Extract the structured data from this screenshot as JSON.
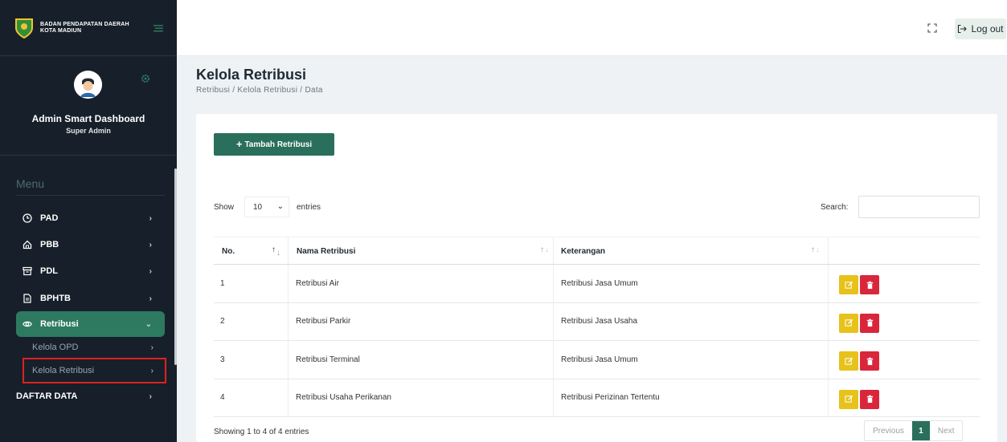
{
  "brand": {
    "text_line1": "BADAN PENDAPATAN DAERAH",
    "text_line2": "KOTA MADIUN",
    "logo_icon": "city-crest-icon",
    "toggle_icon": "menu-toggle-icon"
  },
  "profile": {
    "name": "Admin Smart Dashboard",
    "role": "Super Admin",
    "avatar_icon": "user-avatar-icon",
    "settings_icon": "gear-icon"
  },
  "menu": {
    "header": "Menu",
    "items": [
      {
        "label": "PAD",
        "icon": "clock-icon"
      },
      {
        "label": "PBB",
        "icon": "home-icon"
      },
      {
        "label": "PDL",
        "icon": "archive-icon"
      },
      {
        "label": "BPHTB",
        "icon": "document-icon"
      },
      {
        "label": "Retribusi",
        "icon": "eye-icon",
        "active": true
      }
    ],
    "subitems": [
      {
        "label": "Kelola OPD"
      },
      {
        "label": "Kelola Retribusi"
      }
    ],
    "extra": {
      "label": "DAFTAR DATA"
    }
  },
  "topbar": {
    "fullscreen_icon": "fullscreen-icon",
    "logout_label": "Log out",
    "logout_icon": "logout-icon"
  },
  "page": {
    "title": "Kelola Retribusi",
    "breadcrumb": "Retribusi / Kelola Retribusi / Data"
  },
  "toolbar": {
    "add_label": "Tambah Retribusi"
  },
  "table_controls": {
    "show_label": "Show",
    "entries_value": "10",
    "entries_label": "entries",
    "search_label": "Search:"
  },
  "table": {
    "headers": [
      "No.",
      "Nama Retribusi",
      "Keterangan"
    ],
    "rows": [
      {
        "no": "1",
        "nama": "Retribusi Air",
        "keterangan": "Retribusi Jasa Umum"
      },
      {
        "no": "2",
        "nama": "Retribusi Parkir",
        "keterangan": "Retribusi Jasa Usaha"
      },
      {
        "no": "3",
        "nama": "Retribusi Terminal",
        "keterangan": "Retribusi Jasa Umum"
      },
      {
        "no": "4",
        "nama": "Retribusi Usaha Perikanan",
        "keterangan": "Retribusi Perizinan Tertentu"
      }
    ]
  },
  "footer": {
    "info": "Showing 1 to 4 of 4 entries",
    "prev": "Previous",
    "page": "1",
    "next": "Next"
  },
  "colors": {
    "primary": "#2a6f5b",
    "sidebar": "#17202a",
    "edit": "#e7c21a",
    "delete": "#d9263b"
  }
}
